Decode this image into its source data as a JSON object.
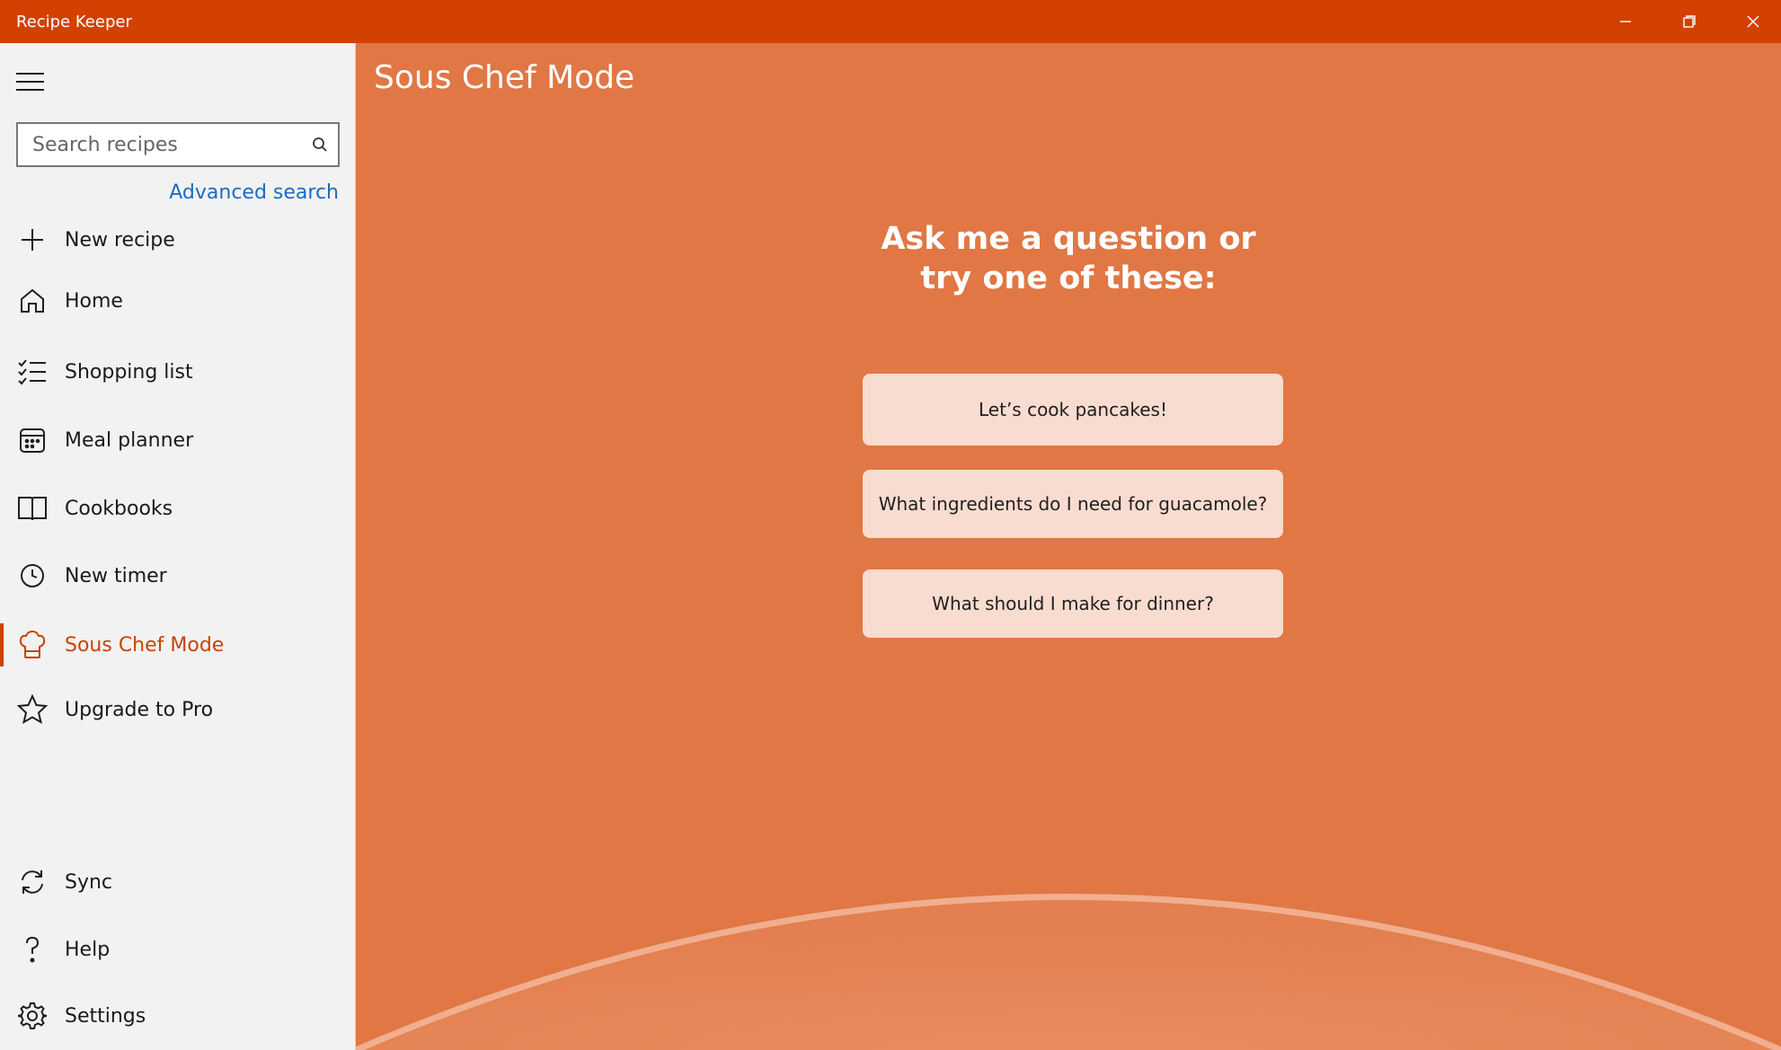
{
  "window": {
    "title": "Recipe Keeper",
    "controls": [
      "minimize-icon",
      "restore-icon",
      "close-icon"
    ]
  },
  "sidebar": {
    "menu_icon": "hamburger-icon",
    "search": {
      "placeholder": "Search recipes",
      "value": "",
      "icon": "search-icon"
    },
    "advanced_search": "Advanced search",
    "nav": [
      {
        "label": "New recipe",
        "icon": "plus-icon"
      },
      {
        "label": "Home",
        "icon": "home-icon"
      },
      {
        "label": "Shopping list",
        "icon": "checklist-icon"
      },
      {
        "label": "Meal planner",
        "icon": "calendar-icon"
      },
      {
        "label": "Cookbooks",
        "icon": "book-icon"
      },
      {
        "label": "New timer",
        "icon": "clock-icon"
      },
      {
        "label": "Sous Chef Mode",
        "icon": "chef-hat-icon",
        "active": true
      },
      {
        "label": "Upgrade to Pro",
        "icon": "star-icon"
      }
    ],
    "bottom_nav": [
      {
        "label": "Sync",
        "icon": "sync-icon"
      },
      {
        "label": "Help",
        "icon": "question-icon"
      },
      {
        "label": "Settings",
        "icon": "gear-icon"
      }
    ]
  },
  "main": {
    "title": "Sous Chef Mode",
    "prompt_line1": "Ask me a question or",
    "prompt_line2": "try one of these:",
    "suggestions": [
      "Let’s cook pancakes!",
      "What ingredients do I need for guacamole?",
      "What should I make for dinner?"
    ]
  },
  "colors": {
    "titlebar": "#d24100",
    "accent": "#c94400",
    "main_background": "#e07745",
    "suggestion_background": "#f8dccf",
    "link": "#1c6ac5"
  }
}
